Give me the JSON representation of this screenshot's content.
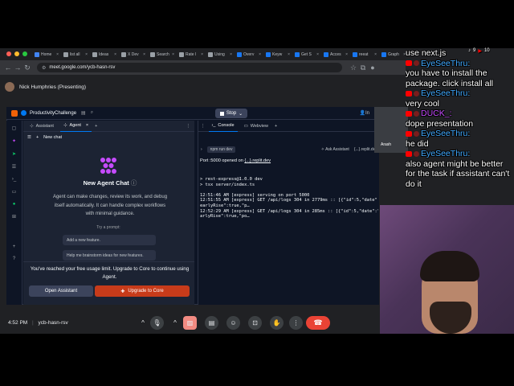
{
  "browser": {
    "tabs": [
      {
        "label": "Home",
        "color": "#4285f4"
      },
      {
        "label": "list all",
        "color": "#9aa0a6"
      },
      {
        "label": "Ideas",
        "color": "#9aa0a6"
      },
      {
        "label": "X Dev",
        "color": "#9aa0a6"
      },
      {
        "label": "Search",
        "color": "#9aa0a6"
      },
      {
        "label": "Rate l",
        "color": "#9aa0a6"
      },
      {
        "label": "Using",
        "color": "#9aa0a6"
      },
      {
        "label": "Overv",
        "color": "#1877f2"
      },
      {
        "label": "Keyw",
        "color": "#1877f2"
      },
      {
        "label": "Get S",
        "color": "#1877f2"
      },
      {
        "label": "Acces",
        "color": "#1877f2"
      },
      {
        "label": "reeat",
        "color": "#1877f2"
      },
      {
        "label": "Graph",
        "color": "#1877f2"
      }
    ],
    "url": "meet.google.com/ycb-hasn-rsv"
  },
  "meet": {
    "presenter": "Nick Humphries (Presenting)",
    "time": "4:52 PM",
    "meeting_code": "ycb-hasn-rsv",
    "participant_tile_name": "Arash"
  },
  "replit": {
    "project": "ProductivityChallenge",
    "stop_label": "Stop",
    "invite_label": "In",
    "agent_tabs": [
      "Assistant",
      "Agent"
    ],
    "new_chat": "New chat",
    "agent_title": "New Agent Chat",
    "agent_desc": "Agent can make changes, review its work, and debug itself automatically. It can handle complex workflows with minimal guidance.",
    "try_label": "Try a prompt:",
    "prompts": [
      "Add a new feature.",
      "Help me brainstorm ideas for new features."
    ],
    "limit_text": "You've reached your free usage limit. Upgrade to Core to continue using Agent.",
    "open_assistant": "Open Assistant",
    "upgrade": "Upgrade to Core",
    "console_tabs": [
      "Console",
      "Webview"
    ],
    "run_label": "npm run dev",
    "ask_assistant": "Ask Assistant",
    "repl_domain": "{...}.replit.dev",
    "port_prefix": "Port :5000 opened on ",
    "port_link": "{...}.replit.dev",
    "console_lines": [
      "> rest-express@1.0.0 dev",
      "> tsx server/index.ts",
      "",
      "12:51:46 AM [express] serving on port 5000",
      "12:51:55 AM [express] GET /api/logs 304 in 2779ms :: [{\"id\":5,\"date\":",
      "earlyRise\":true,\"p…",
      "12:52:29 AM [express] GET /api/logs 304 in 285ms :: [{\"id\":5,\"date\":\"",
      "arlyRise\":true,\"po…"
    ]
  },
  "chat": [
    {
      "user": "",
      "text": "use next.js"
    },
    {
      "user": "EyeSeeThru:",
      "text": "you have to install the package. click install all"
    },
    {
      "user": "EyeSeeThru:",
      "text": "very cool"
    },
    {
      "user": "DUCK_:",
      "text": "dope presentation",
      "pink": true
    },
    {
      "user": "EyeSeeThru:",
      "text": "he did"
    },
    {
      "user": "EyeSeeThru:",
      "text": "also agent might be better for the task if assistant can't do it"
    }
  ],
  "status_top": {
    "a": "9",
    "b": "10"
  }
}
